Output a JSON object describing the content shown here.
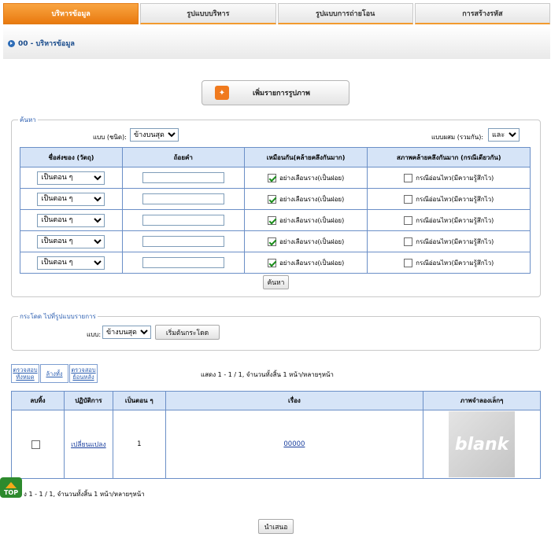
{
  "tabs": [
    "บริหารข้อมูล",
    "รูปแบบบริหาร",
    "รูปแบบการถ่ายโอน",
    "การสร้างรหัส"
  ],
  "breadcrumb": "00 - บริหารข้อมูล",
  "add_button": "เพิ่มรายการรูปภาพ",
  "search": {
    "legend": "ค้นหา",
    "mode_label": "แบบ (ชนิด):",
    "mode_value": "ข้างบนสุด",
    "combine_label": "แบบผสม (รวมกัน):",
    "combine_value": "และ",
    "headers": [
      "ชื่อส่งของ (วัตถุ)",
      "ถ้อยคำ",
      "เหมือนกัน(คล้ายคลึงกันมาก)",
      "สภาพคล้ายคลึงกันมาก (กรณีเดียวกัน)"
    ],
    "rows": [
      {
        "field": "เป็นตอน ๆ",
        "similar": "อย่างเลือนราง(เป็นฝอย)",
        "case": "กรณีอ่อนไหว(มีความรู้สึกไว)"
      },
      {
        "field": "เป็นตอน ๆ",
        "similar": "อย่างเลือนราง(เป็นฝอย)",
        "case": "กรณีอ่อนไหว(มีความรู้สึกไว)"
      },
      {
        "field": "เป็นตอน ๆ",
        "similar": "อย่างเลือนราง(เป็นฝอย)",
        "case": "กรณีอ่อนไหว(มีความรู้สึกไว)"
      },
      {
        "field": "เป็นตอน ๆ",
        "similar": "อย่างเลือนราง(เป็นฝอย)",
        "case": "กรณีอ่อนไหว(มีความรู้สึกไว)"
      },
      {
        "field": "เป็นตอน ๆ",
        "similar": "อย่างเลือนราง(เป็นฝอย)",
        "case": "กรณีอ่อนไหว(มีความรู้สึกไว)"
      }
    ],
    "button": "ค้นหา"
  },
  "jump": {
    "legend": "กระโดด ไปที่รูปแบบรายการ",
    "mode_label": "แบบ:",
    "mode_value": "ข้างบนสุด",
    "button": "เริ่มต้นกระโดด"
  },
  "actions": {
    "check_all": "ตรวจสอบทั้งหมด",
    "clear_all": "ล้างทั้ง",
    "check_reverse": "ตรวจสอบย้อนหลัง"
  },
  "pager_top": "แสดง 1 - 1 / 1, จำนวนทั้งสิ้น 1 หน้า/หลายๆหน้า",
  "pager_bottom": "ง 1 - 1 / 1, จำนวนทั้งสิ้น 1 หน้า/หลายๆหน้า",
  "results": {
    "headers": [
      "ลบทิ้ง",
      "ปฏิบัติการ",
      "เป็นตอน ๆ",
      "เรื่อง",
      "ภาพจำลองเล็กๆ"
    ],
    "row": {
      "action": "เปลี่ยนแปลง",
      "seq": "1",
      "title": "00000",
      "thumb": "blank"
    }
  },
  "top_badge": "TOP",
  "submit_button": "นำเสนอ"
}
